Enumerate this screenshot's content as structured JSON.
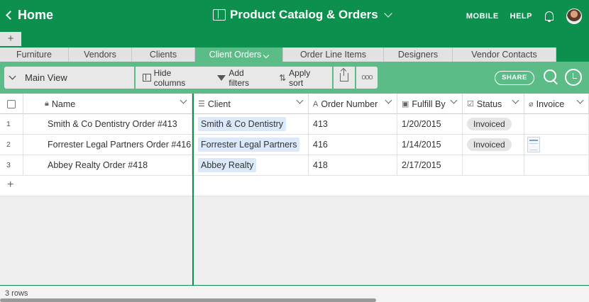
{
  "topbar": {
    "home_label": "Home",
    "base_title": "Product Catalog & Orders",
    "mobile_label": "MOBILE",
    "help_label": "HELP"
  },
  "tabs": [
    {
      "label": "Furniture"
    },
    {
      "label": "Vendors"
    },
    {
      "label": "Clients"
    },
    {
      "label": "Client Orders",
      "active": true
    },
    {
      "label": "Order Line Items"
    },
    {
      "label": "Designers"
    },
    {
      "label": "Vendor Contacts"
    }
  ],
  "viewbar": {
    "view_name": "Main View",
    "hide_columns": "Hide columns",
    "add_filters": "Add filters",
    "apply_sort": "Apply sort",
    "more": "ooo",
    "share": "SHARE"
  },
  "columns": [
    "Name",
    "Client",
    "Order Number",
    "Fulfill By",
    "Status",
    "Invoice"
  ],
  "rows": [
    {
      "num": "1",
      "name": "Smith & Co Dentistry Order #413",
      "client": "Smith & Co Dentistry",
      "order_number": "413",
      "fulfill_by": "1/20/2015",
      "status": "Invoiced"
    },
    {
      "num": "2",
      "name": "Forrester Legal Partners Order #416",
      "client": "Forrester Legal Partners",
      "order_number": "416",
      "fulfill_by": "1/14/2015",
      "status": "Invoiced"
    },
    {
      "num": "3",
      "name": "Abbey Realty Order #418",
      "client": "Abbey Realty",
      "order_number": "418",
      "fulfill_by": "2/17/2015",
      "status": ""
    }
  ],
  "footer": {
    "row_count": "3 rows"
  },
  "colors": {
    "brand_green": "#0d8f4d",
    "active_tab": "#5cbc88"
  }
}
